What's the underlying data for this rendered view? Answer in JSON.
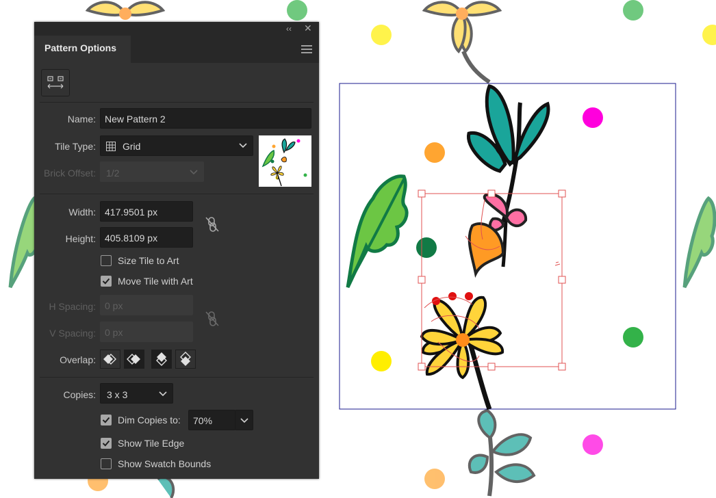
{
  "panel": {
    "title": "Pattern Options",
    "topbar_icons": [
      "double-chevron-left-icon",
      "close-icon"
    ],
    "menu_icon": "hamburger-menu-icon",
    "fit_button_icon": "pattern-tile-tool-icon"
  },
  "fields": {
    "name_label": "Name:",
    "name_value": "New Pattern 2",
    "tile_type_label": "Tile Type:",
    "tile_type_value": "Grid",
    "brick_offset_label": "Brick Offset:",
    "brick_offset_value": "1/2",
    "width_label": "Width:",
    "width_value": "417.9501 px",
    "height_label": "Height:",
    "height_value": "405.8109 px",
    "size_tile_label": "Size Tile to Art",
    "size_tile_checked": false,
    "move_tile_label": "Move Tile with Art",
    "move_tile_checked": true,
    "h_spacing_label": "H Spacing:",
    "h_spacing_value": "0 px",
    "v_spacing_label": "V Spacing:",
    "v_spacing_value": "0 px",
    "overlap_label": "Overlap:",
    "copies_label": "Copies:",
    "copies_value": "3 x 3",
    "dim_copies_label": "Dim Copies to:",
    "dim_copies_checked": true,
    "dim_copies_value": "70%",
    "show_tile_edge_label": "Show Tile Edge",
    "show_tile_edge_checked": true,
    "show_swatch_bounds_label": "Show Swatch Bounds",
    "show_swatch_bounds_checked": false
  },
  "colors": {
    "panel_bg": "#323232",
    "tile_edge": "#1a1a8c",
    "selection": "#e05050",
    "teal": "#1aa59a",
    "leaf_green": "#6cc644",
    "flower_yellow": "#ffd43a",
    "magenta": "#ff00dd",
    "orange": "#ffa531",
    "dark_green": "#117a45",
    "green": "#33b249",
    "yellow": "#ffee00"
  }
}
